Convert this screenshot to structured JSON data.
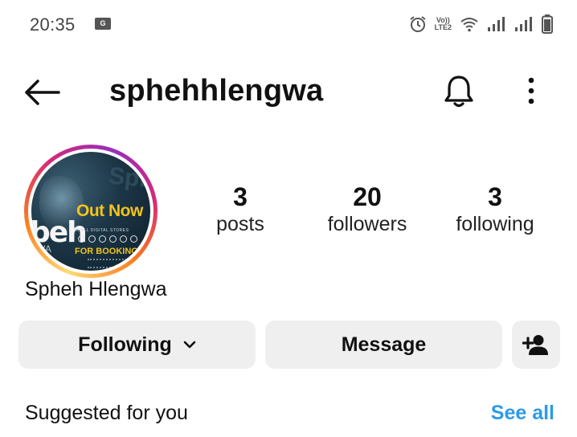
{
  "status_bar": {
    "time": "20:35",
    "badge": "G",
    "volte_top": "Vo))",
    "volte_bottom": "LTE2",
    "icons": [
      "gmail-icon",
      "alarm-icon",
      "volte-icon",
      "wifi-icon",
      "signal-icon",
      "signal-icon",
      "battery-icon"
    ]
  },
  "header": {
    "username": "sphehhlengwa",
    "icons": [
      "back-arrow-icon",
      "bell-icon",
      "more-vertical-icon"
    ]
  },
  "avatar": {
    "text_spheh": "Spheh",
    "text_beh": "beh",
    "text_wa": "WA",
    "text_out_now": "Out Now",
    "text_stores": "IN ALL DIGITAL STORES",
    "text_bookings": "FOR BOOKINGS"
  },
  "stats": {
    "posts_count": "3",
    "posts_label": "posts",
    "followers_count": "20",
    "followers_label": "followers",
    "following_count": "3",
    "following_label": "following"
  },
  "profile": {
    "display_name": "Spheh Hlengwa"
  },
  "actions": {
    "following_label": "Following",
    "message_label": "Message",
    "add_user_icon": "add-person-icon"
  },
  "suggested": {
    "title": "Suggested for you",
    "see_all": "See all"
  },
  "colors": {
    "link_blue": "#2d9be6",
    "button_bg": "#efefef"
  }
}
